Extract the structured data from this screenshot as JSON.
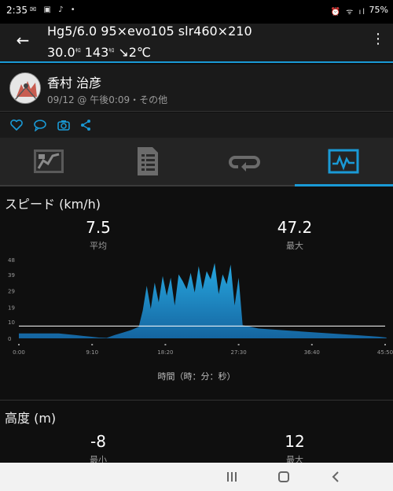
{
  "status_bar": {
    "time": "2:35",
    "battery": "75%",
    "left_icons": "✉ ▣ ♪ •",
    "right_icons": "⏰ ᯤ ıl"
  },
  "header": {
    "line1": "Hg5/6.0  95×evo105 slr460×210",
    "line2_a": "30.0",
    "line2_a_unit": "ｷﾛ",
    "line2_b": "143",
    "line2_b_unit": "ｷﾛ",
    "line2_c": "↘2℃"
  },
  "profile": {
    "name": "香村 治彦",
    "meta": "09/12 @ 午後0:09・その他"
  },
  "speed": {
    "title": "スピード (km/h)",
    "avg_value": "7.5",
    "avg_label": "平均",
    "max_value": "47.2",
    "max_label": "最大",
    "x_axis_title": "時間（時：分：秒）"
  },
  "altitude": {
    "title": "高度 (m)",
    "min_value": "-8",
    "min_label": "最小",
    "max_value": "12",
    "max_label": "最大"
  },
  "colors": {
    "accent": "#1a9ad6",
    "area_top": "#27a8e0",
    "area_bottom": "#1565a0"
  },
  "chart_data": {
    "type": "area",
    "title": "",
    "ylim": [
      0,
      48
    ],
    "y_ticks": [
      "48",
      "39",
      "29",
      "19",
      "10",
      "0"
    ],
    "x_ticks": [
      "0:00",
      "9:10",
      "18:20",
      "27:30",
      "36:40",
      "45:50"
    ],
    "average_line": 7.5,
    "series": [
      {
        "x": [
          0,
          1,
          2,
          3,
          4,
          5,
          6,
          7,
          8,
          9,
          10,
          11,
          12,
          13,
          14,
          15,
          15.5,
          16,
          16.5,
          17,
          17.5,
          18,
          18.5,
          19,
          19.5,
          20,
          20.5,
          21,
          21.5,
          22,
          22.5,
          23,
          23.5,
          24,
          24.5,
          25,
          25.5,
          26,
          26.5,
          27,
          27.5,
          28,
          30,
          33,
          36,
          39,
          42,
          45,
          46
        ],
        "y": [
          3,
          3,
          3,
          3,
          3,
          3,
          2.5,
          2,
          1.5,
          1,
          0.5,
          0.3,
          2,
          3.5,
          5,
          7,
          17,
          32,
          18,
          34,
          22,
          38,
          26,
          37,
          20,
          39,
          35,
          30,
          40,
          28,
          44,
          30,
          41,
          36,
          46,
          27,
          39,
          33,
          45,
          20,
          37,
          8,
          6,
          5,
          4,
          3,
          2,
          1,
          0.5
        ]
      }
    ]
  }
}
